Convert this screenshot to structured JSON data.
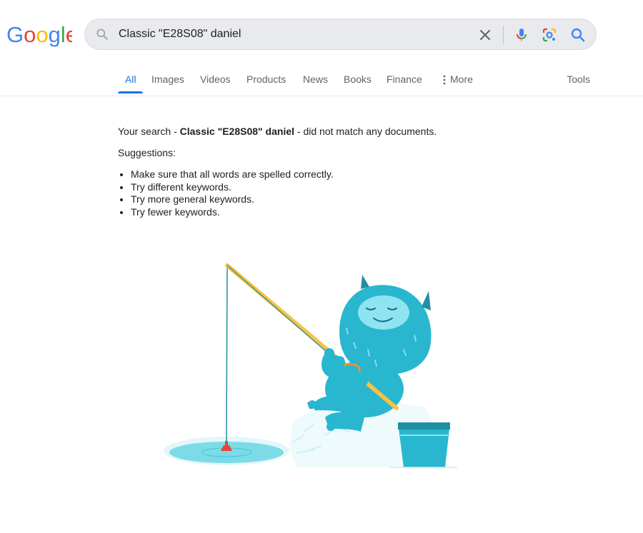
{
  "logo": {
    "text": "Google",
    "colors": [
      "#4285F4",
      "#EA4335",
      "#FBBC05",
      "#4285F4",
      "#34A853",
      "#EA4335"
    ]
  },
  "search": {
    "value": "Classic \"E28S08\" daniel",
    "icons": [
      "search-icon",
      "close-icon",
      "mic-icon",
      "lens-icon",
      "search-icon"
    ]
  },
  "tabs": [
    {
      "label": "All",
      "active": true
    },
    {
      "label": "Images"
    },
    {
      "label": "Videos"
    },
    {
      "label": "Products"
    },
    {
      "label": "News"
    },
    {
      "label": "Books"
    },
    {
      "label": "Finance"
    },
    {
      "label": "More"
    }
  ],
  "tools_label": "Tools",
  "results": {
    "prefix": "Your search - ",
    "query": "Classic \"E28S08\" daniel",
    "suffix": " - did not match any documents.",
    "suggestions_title": "Suggestions:",
    "suggestions": [
      "Make sure that all words are spelled correctly.",
      "Try different keywords.",
      "Try more general keywords.",
      "Try fewer keywords."
    ]
  },
  "colors": {
    "accent": "#1a73e8",
    "illustration_teal": "#29b6cf",
    "rod": "#f6c344",
    "bobber": "#ea4335"
  }
}
